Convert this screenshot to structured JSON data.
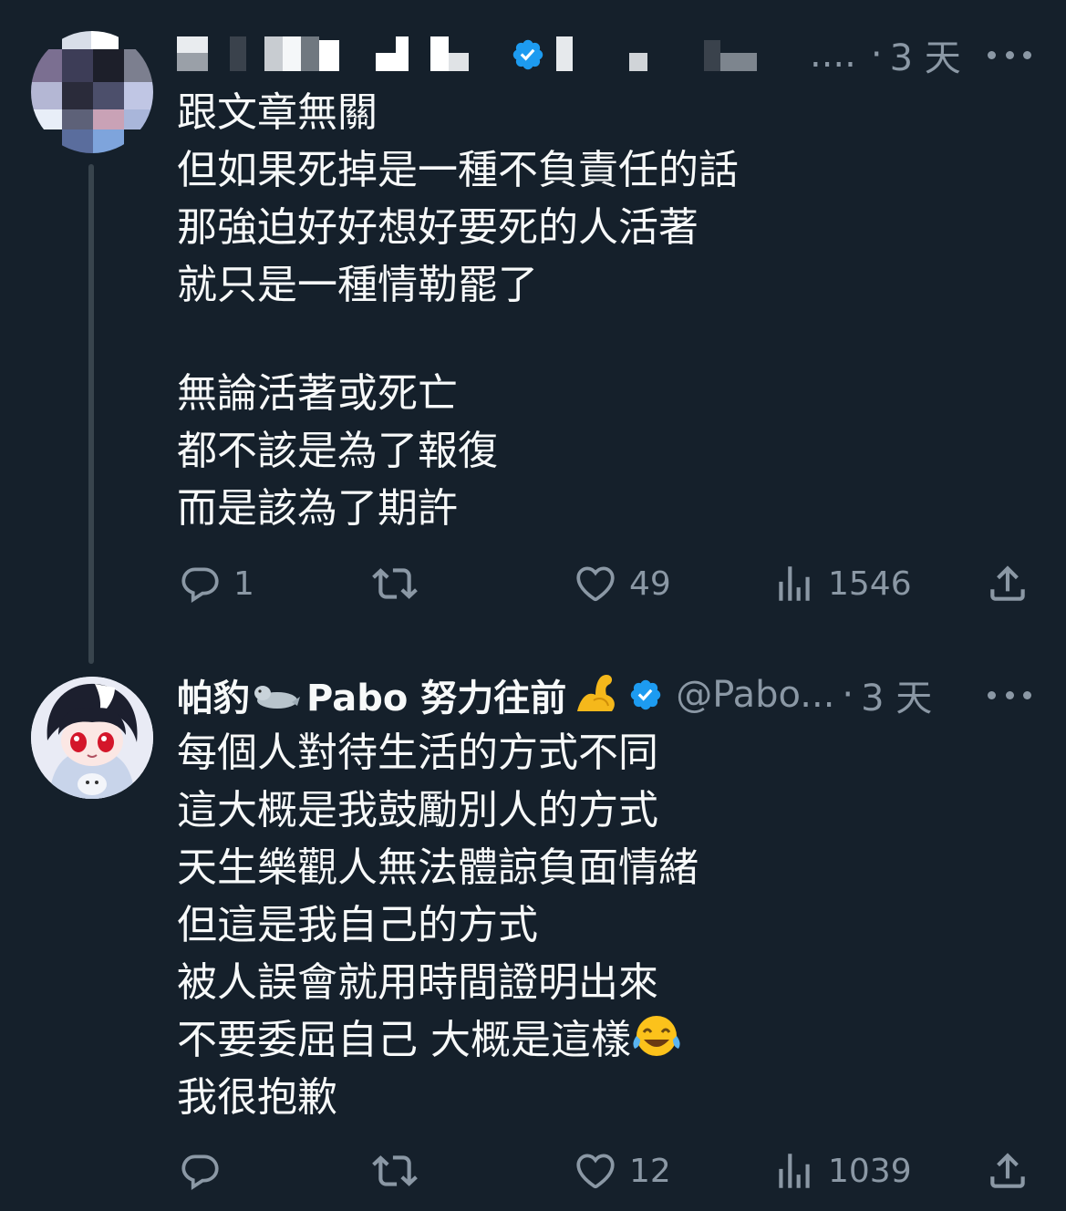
{
  "tweets": [
    {
      "author": {
        "display_name": "",
        "handle": "",
        "handle_suffix": "....",
        "verified": true
      },
      "time": "3 天",
      "lines": [
        "跟文章無關",
        "但如果死掉是一種不負責任的話",
        "那強迫好好想好要死的人活著",
        "就只是一種情勒罷了",
        "",
        "無論活著或死亡",
        "都不該是為了報復",
        "而是該為了期許"
      ],
      "actions": {
        "replies": "1",
        "retweets": "",
        "likes": "49",
        "views": "1546"
      }
    },
    {
      "author": {
        "display_name": "帕豹",
        "display_name_2": "Pabo 努力往前",
        "name_emoji": "seal-emoji",
        "name_emoji_2": "flexed-biceps-emoji",
        "handle": "@Pabo...",
        "verified": true
      },
      "time": "3 天",
      "lines": [
        "每個人對待生活的方式不同",
        "這大概是我鼓勵別人的方式",
        "天生樂觀人無法體諒負面情緒",
        "但這是我自己的方式",
        "被人誤會就用時間證明出來",
        "不要委屈自己 大概是這樣",
        "我很抱歉"
      ],
      "line_emoji": "face-with-tears-of-joy-emoji",
      "actions": {
        "replies": "",
        "retweets": "",
        "likes": "12",
        "views": "1039"
      }
    }
  ],
  "icons": {
    "reply": "reply-icon",
    "retweet": "retweet-icon",
    "like": "heart-icon",
    "views": "views-icon",
    "share": "share-icon",
    "more": "more-icon",
    "verified": "verified-badge-icon"
  },
  "colors": {
    "background": "#15202b",
    "text": "#f7f9f9",
    "muted": "#8b98a5",
    "verified": "#1d9bf0",
    "thread_line": "#38444d"
  }
}
